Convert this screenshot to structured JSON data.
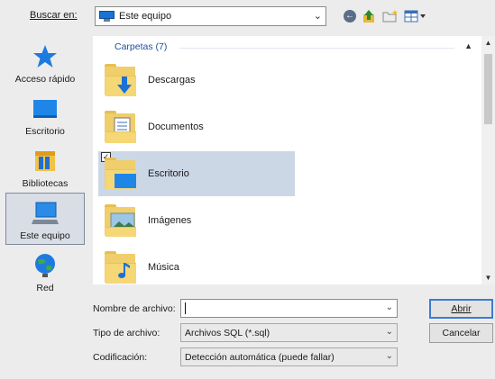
{
  "toolbar": {
    "look_in_label": "Buscar en:",
    "look_in_value": "Este equipo"
  },
  "sidebar": {
    "items": [
      {
        "label": "Acceso rápido"
      },
      {
        "label": "Escritorio"
      },
      {
        "label": "Bibliotecas"
      },
      {
        "label": "Este equipo",
        "selected": true
      },
      {
        "label": "Red"
      }
    ]
  },
  "filelist": {
    "group_header": "Carpetas (7)",
    "items": [
      {
        "name": "Descargas"
      },
      {
        "name": "Documentos"
      },
      {
        "name": "Escritorio",
        "selected": true,
        "checked": true
      },
      {
        "name": "Imágenes"
      },
      {
        "name": "Música"
      }
    ]
  },
  "fields": {
    "filename_label": "Nombre de archivo:",
    "filename_value": "",
    "filetype_label": "Tipo de archivo:",
    "filetype_value": "Archivos SQL (*.sql)",
    "encoding_label": "Codificación:",
    "encoding_value": "Detección automática (puede fallar)"
  },
  "buttons": {
    "open": "Abrir",
    "cancel": "Cancelar"
  },
  "colors": {
    "selection": "#ccd7e6",
    "group_header": "#1e4e9c",
    "default_button_border": "#3d7bd6"
  }
}
